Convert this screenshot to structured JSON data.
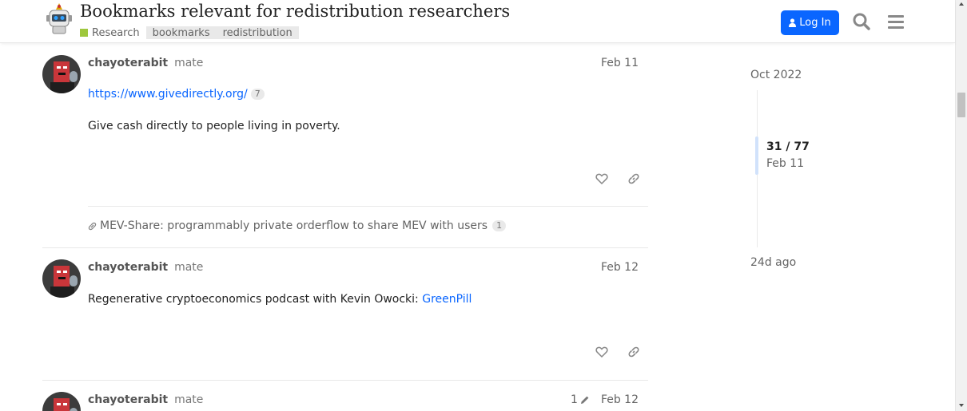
{
  "header": {
    "title": "Bookmarks relevant for redistribution researchers",
    "category": "Research",
    "category_color": "#9ec73d",
    "tags": [
      "bookmarks",
      "redistribution"
    ],
    "login_label": "Log In",
    "accent": "#0a66ff"
  },
  "posts": [
    {
      "username": "chayoterabit",
      "user_title": "mate",
      "date": "Feb 11",
      "link_text": "https://www.givedirectly.org/",
      "click_count": "7",
      "body": "Give cash directly to people living in poverty."
    },
    {
      "username": "chayoterabit",
      "user_title": "mate",
      "date": "Feb 12",
      "body_prefix": "Regenerative cryptoeconomics podcast with Kevin Owocki: ",
      "link_text": "GreenPill"
    },
    {
      "username": "chayoterabit",
      "user_title": "mate",
      "date": "Feb 12",
      "edit_count": "1"
    }
  ],
  "linked_topic": {
    "title": "MEV-Share: programmably private orderflow to share MEV with users",
    "count": "1"
  },
  "timeline": {
    "start": "Oct 2022",
    "position": "31 / 77",
    "current_date": "Feb 11",
    "end": "24d ago"
  },
  "icons": {
    "like": "heart-icon",
    "share": "link-icon",
    "search": "search-icon",
    "menu": "hamburger-icon",
    "login": "user-icon",
    "edit": "pencil-icon"
  }
}
